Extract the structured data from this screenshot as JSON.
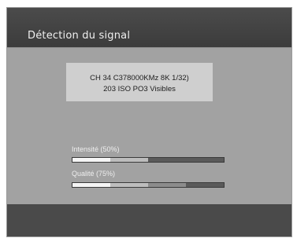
{
  "window": {
    "title": "Détection du signal"
  },
  "info": {
    "line1": "CH 34 C378000KMz 8K 1/32)",
    "line2": "203 ISO PO3 Visibles"
  },
  "meters": [
    {
      "label": "Intensité (50%)",
      "value": 0.5
    },
    {
      "label": "Qualité (75%)",
      "value": 0.75
    }
  ],
  "colors": {
    "background": "#a2a2a2",
    "title_bar": "#444444",
    "info_box": "#cfcfcf",
    "bar_track": "#5a5a5a",
    "bar_fill_white": "#f5f5f5",
    "bar_fill_light": "#bdbdbd",
    "bar_fill_mid": "#8c8c8c"
  }
}
